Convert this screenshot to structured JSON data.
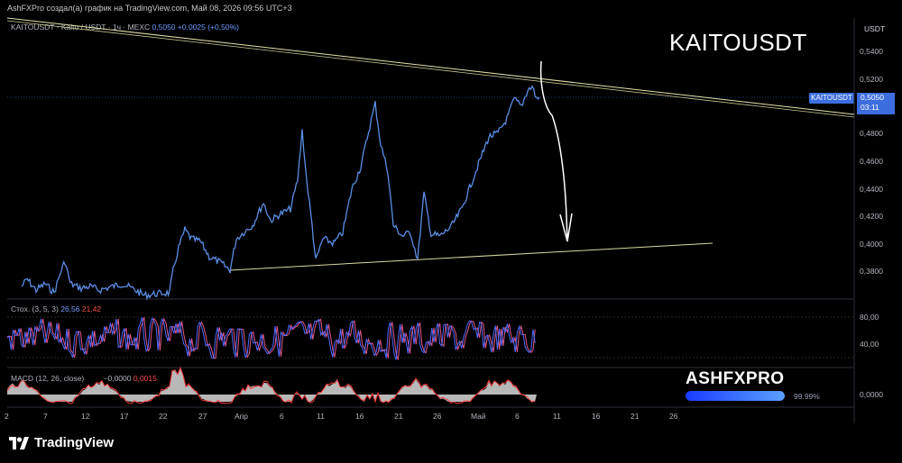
{
  "header": {
    "title": "AshFXPro создал(а) график на TradingView.com, Май 08, 2026 09:56 UTC+3"
  },
  "legend": {
    "symbol_text": "KAITOUSDT · Kaito / USDT · 1ч · MEXC",
    "last_price": "0,5050",
    "change": "+0,0025 (+0,50%)"
  },
  "watermark_title": "KAITOUSDT",
  "axis": {
    "unit": "USDT",
    "price_ticks": [
      "0,5400",
      "0,5200",
      "0,4800",
      "0,4600",
      "0,4400",
      "0,4200",
      "0,4000",
      "0,3800"
    ],
    "date_ticks": [
      "2",
      "7",
      "12",
      "17",
      "22",
      "27",
      "Апр",
      "6",
      "11",
      "16",
      "21",
      "26",
      "Май",
      "6",
      "11",
      "16",
      "21",
      "26"
    ]
  },
  "price_badge": {
    "symbol": "KAITOUSDT",
    "price": "0,5050",
    "countdown": "03:11"
  },
  "stoch": {
    "label": "Стох. (3, 5, 3)",
    "k": "26,56",
    "d": "21,42",
    "ticks": [
      "80,00",
      "40,00"
    ]
  },
  "macd": {
    "label": "MACD (12, 26, close)",
    "val1": "−0,0000",
    "val2": "0,0015",
    "tick": "0,0000"
  },
  "brand": {
    "name": "ASHFXPRO",
    "progress": 0.9999,
    "progress_text": "99.99%"
  },
  "footer": {
    "logo_text": "TradingView"
  },
  "colors": {
    "price_line": "#5b8ee6",
    "stoch_k": "#4f6bff",
    "stoch_d": "#e0578a",
    "macd_hist": "#b8b8b8",
    "macd_line": "#ff3b3b",
    "trendline": "#d8d8a0",
    "accent": "#3d6ee0"
  }
}
